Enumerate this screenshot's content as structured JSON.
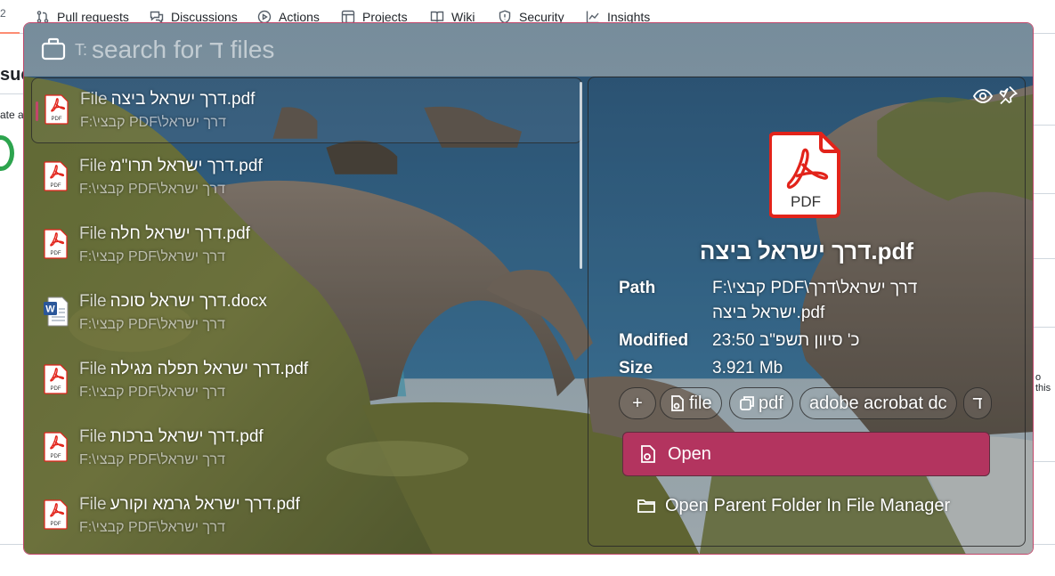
{
  "github_nav": {
    "count": "2",
    "tabs": [
      "Pull requests",
      "Discussions",
      "Actions",
      "Projects",
      "Wiki",
      "Security",
      "Insights"
    ],
    "edge_text_1": "sue",
    "edge_text_2": "ate a",
    "edge_text_3": "o this"
  },
  "launcher": {
    "search_prefix": "T:",
    "search_placeholder": "search for ד files",
    "items": [
      {
        "kind": "File",
        "name": "דרך ישראל ביצה.pdf",
        "path": "F:\\קבצי PDF\\דרך ישראל",
        "type": "pdf"
      },
      {
        "kind": "File",
        "name": "דרך ישראל תרו\"מ.pdf",
        "path": "F:\\קבצי PDF\\דרך ישראל",
        "type": "pdf"
      },
      {
        "kind": "File",
        "name": "דרך ישראל חלה.pdf",
        "path": "F:\\קבצי PDF\\דרך ישראל",
        "type": "pdf"
      },
      {
        "kind": "File",
        "name": "דרך ישראל סוכה.docx",
        "path": "F:\\קבצי PDF\\דרך ישראל",
        "type": "docx"
      },
      {
        "kind": "File",
        "name": "דרך ישראל תפלה מגילה.pdf",
        "path": "F:\\קבצי PDF\\דרך ישראל",
        "type": "pdf"
      },
      {
        "kind": "File",
        "name": "דרך ישראל ברכות.pdf",
        "path": "F:\\קבצי PDF\\דרך ישראל",
        "type": "pdf"
      },
      {
        "kind": "File",
        "name": "דרך ישראל גרמא וקורע.pdf",
        "path": "F:\\קבצי PDF\\דרך ישראל",
        "type": "pdf"
      }
    ],
    "detail": {
      "file_type_label": "PDF",
      "title": "דרך ישראל ביצה.pdf",
      "path_label": "Path",
      "path_value_line1": "F:\\קבצי PDF\\דרך ישראל\\דרך",
      "path_value_line2": "ישראל ביצה.pdf",
      "modified_label": "Modified",
      "modified_value": "כ' סיוון תשפ\"ב 23:50",
      "size_label": "Size",
      "size_value": "3.921 Mb",
      "chip_add": "+",
      "chip_file": "file",
      "chip_pdf": "pdf",
      "chip_app": "adobe acrobat dc",
      "chip_letter": "ד",
      "open_label": "Open",
      "open_parent_label": "Open Parent Folder In File Manager"
    }
  },
  "colors": {
    "accent": "#b3345f",
    "border": "#c2466a",
    "pdf_red": "#e2231a"
  }
}
